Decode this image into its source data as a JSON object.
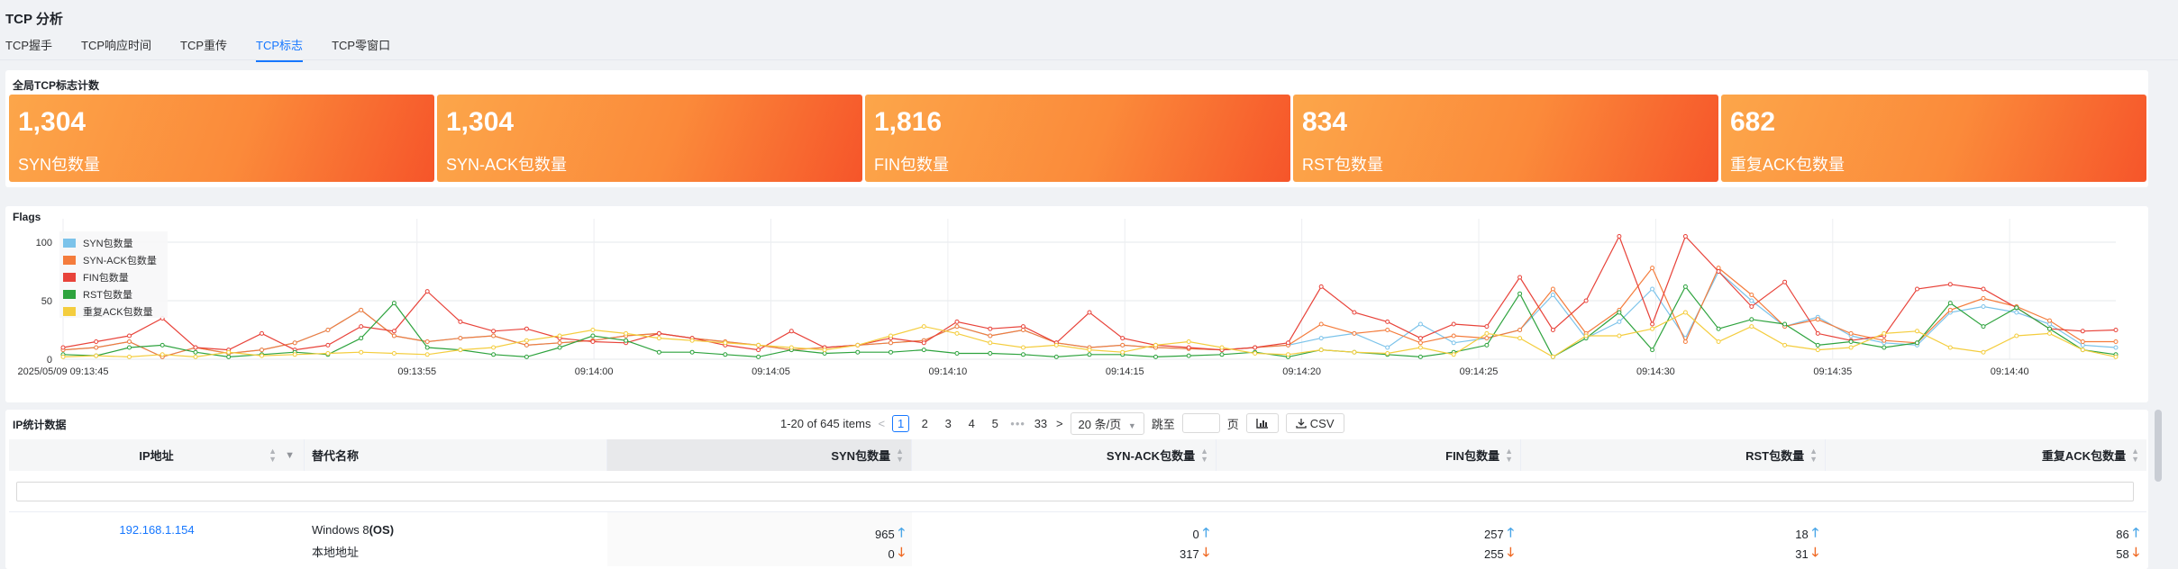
{
  "page": {
    "title": "TCP 分析"
  },
  "tabs": [
    {
      "label": "TCP握手",
      "active": false
    },
    {
      "label": "TCP响应时间",
      "active": false
    },
    {
      "label": "TCP重传",
      "active": false
    },
    {
      "label": "TCP标志",
      "active": true
    },
    {
      "label": "TCP零窗口",
      "active": false
    }
  ],
  "global_counts": {
    "title": "全局TCP标志计数",
    "cards": [
      {
        "value": "1,304",
        "label": "SYN包数量"
      },
      {
        "value": "1,304",
        "label": "SYN-ACK包数量"
      },
      {
        "value": "1,816",
        "label": "FIN包数量"
      },
      {
        "value": "834",
        "label": "RST包数量"
      },
      {
        "value": "682",
        "label": "重复ACK包数量"
      }
    ]
  },
  "chart_data": {
    "type": "line",
    "title": "Flags",
    "ylim": [
      0,
      120
    ],
    "yticks": [
      0,
      50,
      100
    ],
    "grid": true,
    "legend_position": "top-left",
    "x_start": "2025/05/09 09:13:45",
    "x_end": "2025/05/09 09:14:43",
    "x_tick_labels": [
      "2025/05/09 09:13:45",
      "09:13:55",
      "09:14:00",
      "09:14:05",
      "09:14:10",
      "09:14:15",
      "09:14:20",
      "09:14:25",
      "09:14:30",
      "09:14:35",
      "09:14:40"
    ],
    "series": [
      {
        "name": "SYN包数量",
        "color": "#7cc3ea",
        "values": [
          8,
          10,
          15,
          2,
          10,
          5,
          8,
          14,
          25,
          42,
          20,
          15,
          18,
          20,
          12,
          14,
          16,
          20,
          22,
          18,
          15,
          12,
          8,
          10,
          12,
          14,
          16,
          28,
          20,
          25,
          14,
          10,
          12,
          10,
          9,
          8,
          10,
          12,
          18,
          22,
          10,
          30,
          14,
          18,
          25,
          55,
          18,
          32,
          60,
          18,
          75,
          50,
          28,
          36,
          20,
          14,
          12,
          40,
          45,
          40,
          30,
          12,
          10
        ]
      },
      {
        "name": "SYN-ACK包数量",
        "color": "#f47c3c",
        "values": [
          8,
          10,
          15,
          2,
          10,
          5,
          8,
          14,
          25,
          42,
          20,
          15,
          18,
          20,
          12,
          14,
          16,
          20,
          22,
          18,
          15,
          12,
          8,
          10,
          12,
          14,
          16,
          28,
          20,
          25,
          14,
          10,
          12,
          10,
          9,
          8,
          10,
          12,
          30,
          22,
          25,
          14,
          20,
          18,
          25,
          60,
          22,
          42,
          78,
          15,
          78,
          55,
          28,
          34,
          22,
          16,
          14,
          42,
          52,
          45,
          33,
          15,
          15
        ]
      },
      {
        "name": "FIN包数量",
        "color": "#e8433a",
        "values": [
          10,
          15,
          20,
          35,
          10,
          8,
          22,
          8,
          12,
          28,
          24,
          58,
          32,
          24,
          26,
          18,
          15,
          14,
          22,
          18,
          12,
          8,
          24,
          10,
          12,
          18,
          14,
          32,
          26,
          28,
          14,
          40,
          18,
          12,
          10,
          8,
          10,
          14,
          62,
          40,
          32,
          18,
          30,
          28,
          70,
          25,
          50,
          105,
          30,
          105,
          75,
          45,
          66,
          22,
          16,
          20,
          60,
          64,
          60,
          44,
          26,
          24,
          25
        ]
      },
      {
        "name": "RST包数量",
        "color": "#2ea33e",
        "values": [
          4,
          3,
          10,
          12,
          6,
          2,
          4,
          6,
          4,
          18,
          48,
          10,
          8,
          4,
          2,
          10,
          20,
          16,
          6,
          6,
          4,
          2,
          8,
          5,
          6,
          6,
          8,
          5,
          5,
          4,
          2,
          4,
          4,
          2,
          3,
          4,
          6,
          2,
          8,
          6,
          4,
          2,
          6,
          12,
          56,
          2,
          18,
          40,
          8,
          62,
          26,
          34,
          30,
          12,
          15,
          10,
          14,
          48,
          28,
          44,
          26,
          8,
          4
        ]
      },
      {
        "name": "重复ACK包数量",
        "color": "#f4cd3e",
        "values": [
          2,
          3,
          2,
          4,
          2,
          6,
          3,
          4,
          5,
          6,
          5,
          4,
          8,
          10,
          16,
          20,
          25,
          22,
          18,
          16,
          14,
          12,
          10,
          8,
          12,
          20,
          28,
          22,
          14,
          10,
          12,
          8,
          6,
          12,
          15,
          10,
          5,
          4,
          8,
          6,
          5,
          10,
          4,
          22,
          18,
          2,
          20,
          20,
          26,
          40,
          15,
          28,
          12,
          8,
          10,
          22,
          24,
          10,
          6,
          20,
          22,
          8,
          2
        ]
      }
    ]
  },
  "ip_stats": {
    "title": "IP统计数据",
    "pagination": {
      "range_text": "1-20 of 645 items",
      "prev": "<",
      "next": ">",
      "pages": [
        "1",
        "2",
        "3",
        "4",
        "5"
      ],
      "current": "1",
      "ellipsis": "•••",
      "last_page": "33",
      "page_size": "20 条/页",
      "jump_label": "跳至",
      "jump_unit": "页",
      "chart_button_icon": "chart-icon",
      "csv_button": "CSV"
    },
    "columns": [
      "IP地址",
      "替代名称",
      "SYN包数量",
      "SYN-ACK包数量",
      "FIN包数量",
      "RST包数量",
      "重复ACK包数量"
    ],
    "rows": [
      {
        "ip": "192.168.1.154",
        "alias_line1": "Windows 8",
        "alias_line1_suffix": "(OS)",
        "alias_line2": "本地地址",
        "syn": [
          "965",
          "0"
        ],
        "syn_ack": [
          "0",
          "317"
        ],
        "fin": [
          "257",
          "255"
        ],
        "rst": [
          "18",
          "31"
        ],
        "dup_ack": [
          "86",
          "58"
        ]
      }
    ]
  }
}
